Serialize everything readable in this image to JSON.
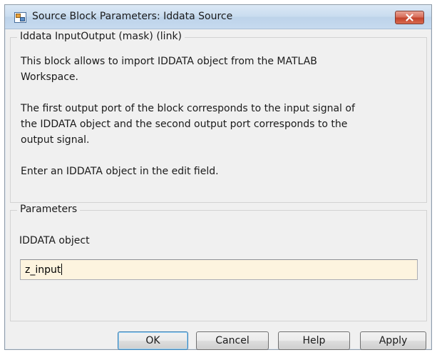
{
  "window": {
    "title": "Source Block Parameters: Iddata Source",
    "icon": "simulink-block-icon",
    "close_icon": "close-icon"
  },
  "mask_group": {
    "legend": "Iddata InputOutput (mask) (link)",
    "description": [
      "This block allows to import IDDATA object from the MATLAB",
      "Workspace.",
      "The first output port of the block corresponds to the input signal of",
      "the IDDATA object and the second output port corresponds to the",
      "output signal.",
      "Enter an IDDATA object in the edit field."
    ]
  },
  "parameters_group": {
    "legend": "Parameters",
    "field_label": "IDDATA object",
    "field_value": "z_input"
  },
  "buttons": {
    "ok": "OK",
    "cancel": "Cancel",
    "help": "Help",
    "apply": "Apply"
  },
  "colors": {
    "input_background": "#fdf4df",
    "close_button": "#c3432c",
    "dialog_background": "#f0f0f0"
  }
}
